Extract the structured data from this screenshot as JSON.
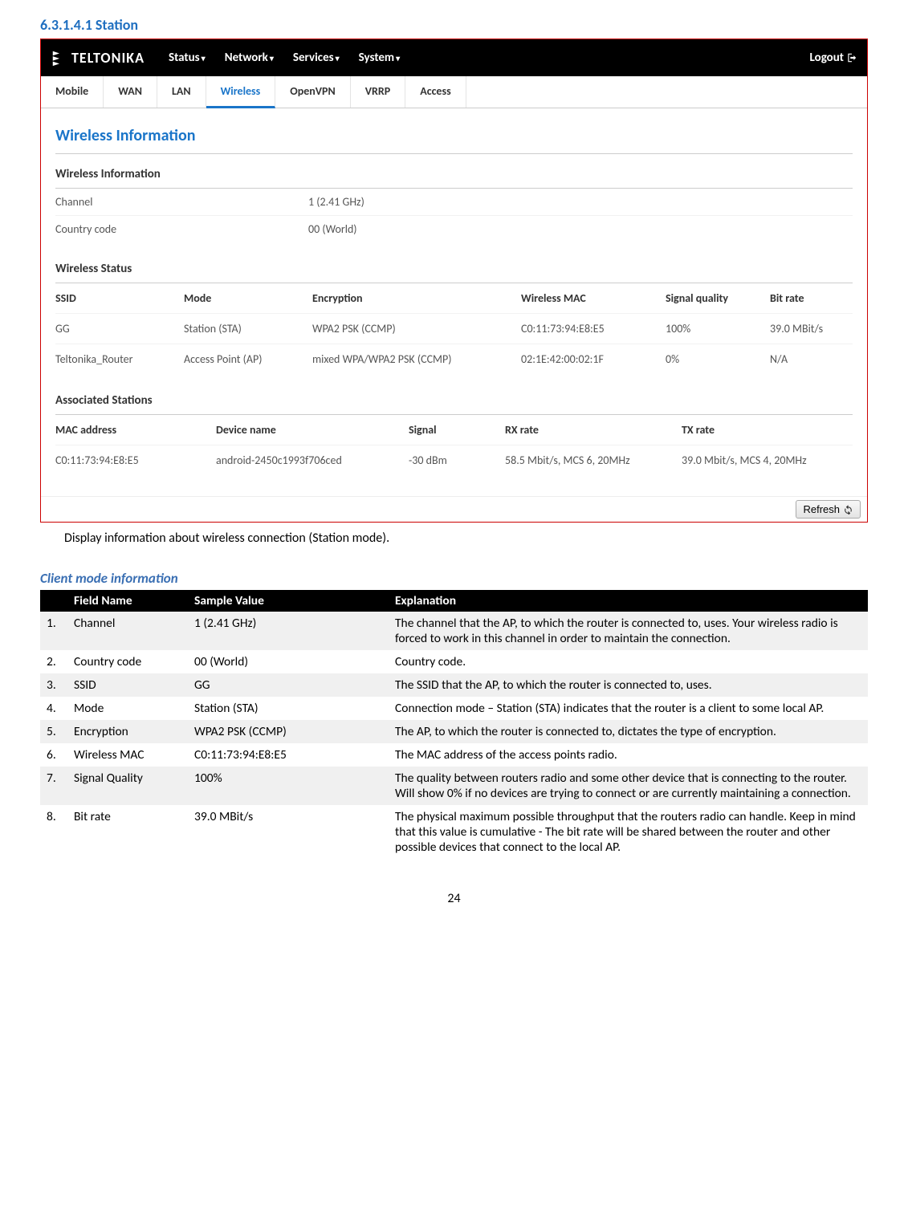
{
  "heading": "6.3.1.4.1   Station",
  "screenshot": {
    "brand": "TELTONIKA",
    "menu": [
      "Status",
      "Network",
      "Services",
      "System"
    ],
    "logout": "Logout",
    "tabs": [
      "Mobile",
      "WAN",
      "LAN",
      "Wireless",
      "OpenVPN",
      "VRRP",
      "Access"
    ],
    "active_tab": "Wireless",
    "page_title": "Wireless Information",
    "wi_section": {
      "title": "Wireless Information",
      "channel_label": "Channel",
      "channel_value": "1 (2.41 GHz)",
      "country_label": "Country code",
      "country_value": "00 (World)"
    },
    "ws_section": {
      "title": "Wireless Status",
      "headers": {
        "ssid": "SSID",
        "mode": "Mode",
        "enc": "Encryption",
        "mac": "Wireless MAC",
        "sig": "Signal quality",
        "bit": "Bit rate"
      },
      "rows": [
        {
          "ssid": "GG",
          "mode": "Station (STA)",
          "enc": "WPA2 PSK (CCMP)",
          "mac": "C0:11:73:94:E8:E5",
          "sig": "100%",
          "bit": "39.0 MBit/s"
        },
        {
          "ssid": "Teltonika_Router",
          "mode": "Access Point (AP)",
          "enc": "mixed WPA/WPA2 PSK (CCMP)",
          "mac": "02:1E:42:00:02:1F",
          "sig": "0%",
          "bit": "N/A"
        }
      ]
    },
    "as_section": {
      "title": "Associated Stations",
      "headers": {
        "mac": "MAC address",
        "dev": "Device name",
        "sig": "Signal",
        "rx": "RX rate",
        "tx": "TX rate"
      },
      "rows": [
        {
          "mac": "C0:11:73:94:E8:E5",
          "dev": "android-2450c1993f706ced",
          "sig": "-30 dBm",
          "rx": "58.5 Mbit/s, MCS 6, 20MHz",
          "tx": "39.0 Mbit/s, MCS 4, 20MHz"
        }
      ]
    },
    "refresh": "Refresh"
  },
  "caption": "Display information about wireless connection (Station mode).",
  "client_heading": "Client mode information",
  "table": {
    "headers": {
      "num": "",
      "field": "Field Name",
      "sample": "Sample Value",
      "explanation": "Explanation"
    },
    "rows": [
      {
        "n": "1.",
        "field": "Channel",
        "sample": "1 (2.41 GHz)",
        "explanation": "The channel that the AP, to which the router is connected to, uses. Your wireless radio is forced to work in this channel in order to maintain the connection."
      },
      {
        "n": "2.",
        "field": "Country code",
        "sample": "00 (World)",
        "explanation": "Country code."
      },
      {
        "n": "3.",
        "field": "SSID",
        "sample": "GG",
        "explanation": "The SSID that the AP, to which the router is connected to, uses."
      },
      {
        "n": "4.",
        "field": "Mode",
        "sample": "Station (STA)",
        "explanation": "Connection mode – Station (STA) indicates that the router is a client to some local AP."
      },
      {
        "n": "5.",
        "field": "Encryption",
        "sample": "WPA2 PSK (CCMP)",
        "explanation": "The AP, to which the router is connected to, dictates the type of encryption."
      },
      {
        "n": "6.",
        "field": "Wireless MAC",
        "sample": "C0:11:73:94:E8:E5",
        "explanation": "The MAC address of the access points radio."
      },
      {
        "n": "7.",
        "field": "Signal Quality",
        "sample": "100%",
        "explanation": "The quality between routers radio and some other device that is connecting to the router. Will show 0% if no devices are trying to connect or are currently maintaining a connection."
      },
      {
        "n": "8.",
        "field": "Bit rate",
        "sample": "39.0 MBit/s",
        "explanation": "The physical maximum possible throughput that the routers radio can handle. Keep in mind that this value is cumulative - The bit rate will be shared between the router and other possible devices that connect to the local AP."
      }
    ]
  },
  "page_number": "24"
}
